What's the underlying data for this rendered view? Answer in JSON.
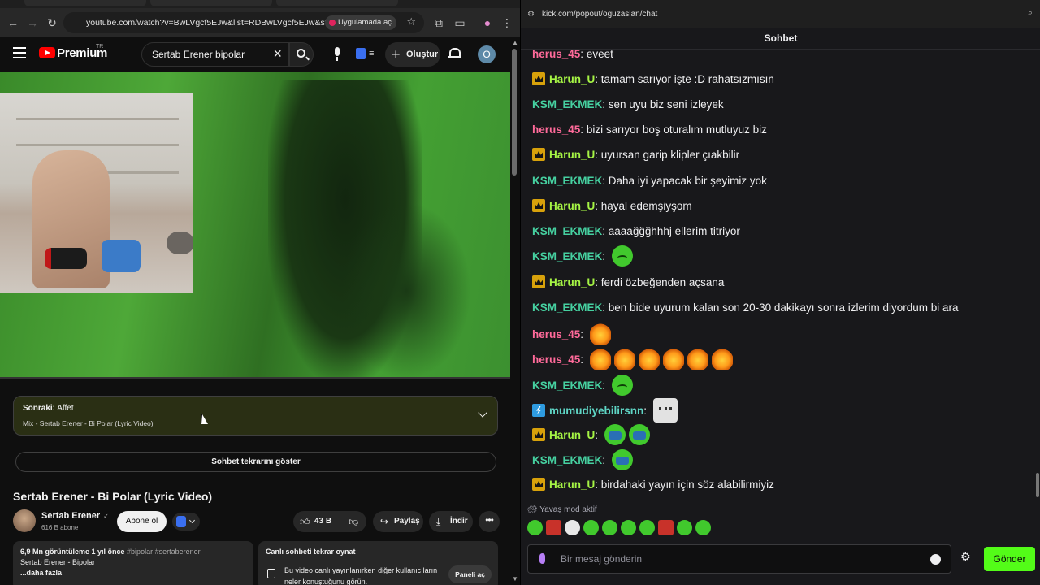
{
  "browser": {
    "url": "youtube.com/watch?v=BwLVgcf5EJw&list=RDBwLVgcf5EJw&start_radi...",
    "open_in_app": "Uygulamada aç"
  },
  "youtube": {
    "brand": "Premium",
    "region": "TR",
    "search_query": "Sertab Erener bipolar",
    "create_label": "Oluştur",
    "avatar_letter": "O",
    "up_next": {
      "prefix": "Sonraki:",
      "title": "Affet",
      "subtitle": "Mix - Sertab Erener - Bi Polar (Lyric Video)"
    },
    "replay_chat_label": "Sohbet tekrarını göster",
    "video_title": "Sertab Erener - Bi Polar (Lyric Video)",
    "channel_name": "Sertab Erener",
    "subscribers": "616 B abone",
    "subscribe_label": "Abone ol",
    "likes": "43 B",
    "share_label": "Paylaş",
    "download_label": "İndir",
    "description": {
      "stats": "6,9 Mn görüntüleme  1 yıl önce",
      "tags": "#bipolar #sertaberener",
      "line2": "Sertab Erener - Bipolar",
      "more": "...daha fazla"
    },
    "live_chat_card": {
      "title": "Canlı sohbeti tekrar oynat",
      "body": "Bu video canlı yayınlanırken diğer kullanıcıların neler konuştuğunu görün.",
      "button": "Paneli aç"
    }
  },
  "kick": {
    "url": "kick.com/popout/oguzaslan/chat",
    "header": "Sohbet",
    "messages": [
      {
        "user": "herus_45",
        "text": "eveet"
      },
      {
        "user": "Harun_U",
        "text": "tamam sarıyor işte :D rahatsızmısın"
      },
      {
        "user": "KSM_EKMEK",
        "text": "sen uyu biz seni izleyek"
      },
      {
        "user": "herus_45",
        "text": "bizi sarıyor boş oturalım mutluyuz biz"
      },
      {
        "user": "Harun_U",
        "text": "uyursan garip klipler çıakbilir"
      },
      {
        "user": "KSM_EKMEK",
        "text": "Daha iyi yapacak bir şeyimiz yok"
      },
      {
        "user": "Harun_U",
        "text": "hayal edemşiyşom"
      },
      {
        "user": "KSM_EKMEK",
        "text": "aaaağğğhhhj ellerim titriyor"
      },
      {
        "user": "KSM_EKMEK",
        "text": ""
      },
      {
        "user": "Harun_U",
        "text": "ferdi özbeğenden açsana"
      },
      {
        "user": "KSM_EKMEK",
        "text": "ben bide uyurum kalan son 20-30 dakikayı sonra izlerim diyordum bi ara"
      },
      {
        "user": "herus_45",
        "text": ""
      },
      {
        "user": "herus_45",
        "text": ""
      },
      {
        "user": "KSM_EKMEK",
        "text": ""
      },
      {
        "user": "mumudiyebilirsnn",
        "text": ""
      },
      {
        "user": "Harun_U",
        "text": ""
      },
      {
        "user": "KSM_EKMEK",
        "text": ""
      },
      {
        "user": "Harun_U",
        "text": "birdahaki yayın için söz alabilirmiyiz"
      }
    ],
    "slow_mode": "Yavaş mod aktif",
    "input_placeholder": "Bir mesaj gönderin",
    "send_label": "Gönder"
  },
  "colors": {
    "kick_green": "#53fc18",
    "herus_color": "#ff6a9a",
    "harun_color": "#a6f545",
    "ksm_color": "#46d1a1",
    "youtube_red": "#ff0000"
  }
}
